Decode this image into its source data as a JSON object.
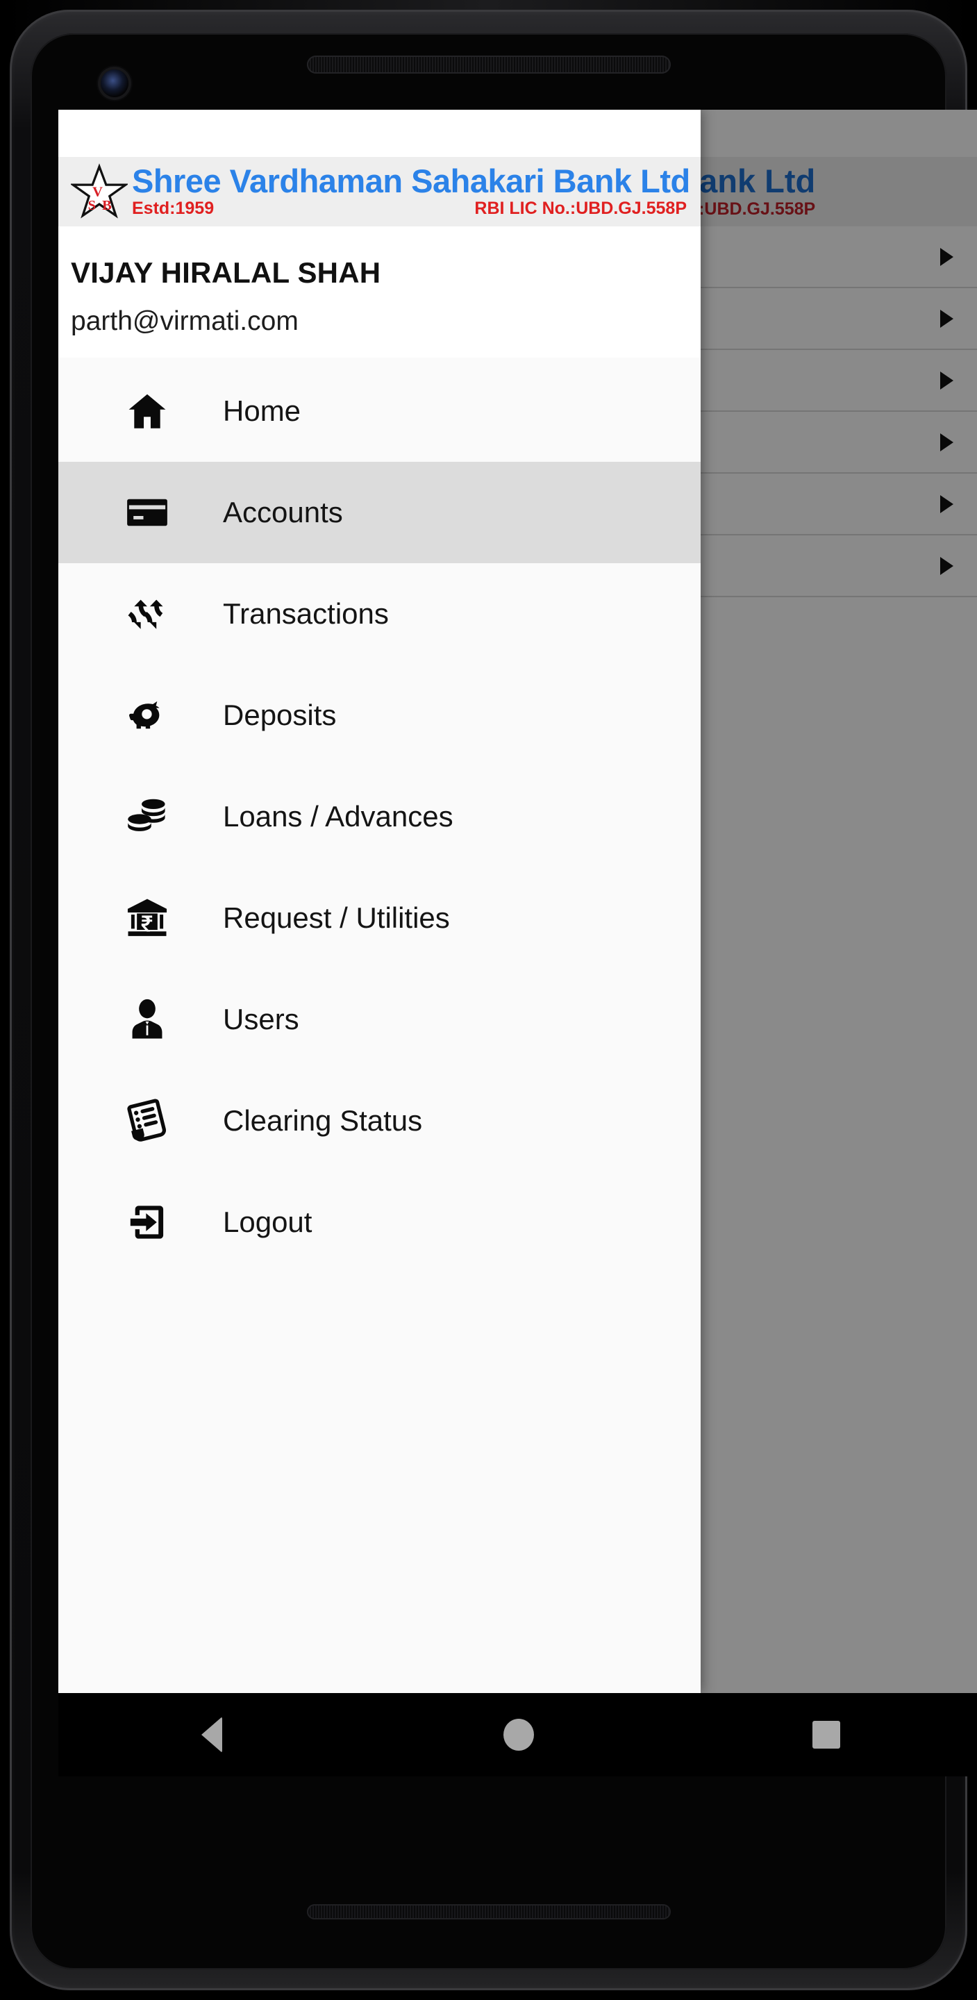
{
  "device": {
    "type": "android-phone",
    "camera_icon": "front-camera",
    "speaker_icon": "speaker-grille"
  },
  "bank_header": {
    "logo_icon": "star-logo-vsb",
    "logo_initials": "V S B",
    "name": "Shree Vardhaman Sahakari Bank Ltd",
    "established": "Estd:1959",
    "license": "RBI LIC No.:UBD.GJ.558P",
    "name_color": "#2b82e8",
    "sub_color": "#e02020",
    "band_bg": "#eeeeee"
  },
  "drawer": {
    "user": {
      "name": "VIJAY HIRALAL SHAH",
      "email": "parth@virmati.com"
    },
    "active_item": "Accounts",
    "active_bg": "#dcdcdc",
    "items": [
      {
        "label": "Home",
        "icon": "home-icon",
        "active": false
      },
      {
        "label": "Accounts",
        "icon": "credit-card-icon",
        "active": true
      },
      {
        "label": "Transactions",
        "icon": "exchange-arrows-icon",
        "active": false
      },
      {
        "label": "Deposits",
        "icon": "piggy-bank-icon",
        "active": false
      },
      {
        "label": "Loans / Advances",
        "icon": "coin-stack-icon",
        "active": false
      },
      {
        "label": "Request / Utilities",
        "icon": "bank-rupee-icon",
        "active": false
      },
      {
        "label": "Users",
        "icon": "user-person-icon",
        "active": false
      },
      {
        "label": "Clearing Status",
        "icon": "document-list-icon",
        "active": false
      },
      {
        "label": "Logout",
        "icon": "logout-arrow-icon",
        "active": false
      }
    ]
  },
  "background_app": {
    "scrim_color": "rgba(0,0,0,0.46)",
    "rows": [
      {
        "arrow_icon": "chevron-right-triangle-icon"
      },
      {
        "arrow_icon": "chevron-right-triangle-icon"
      },
      {
        "arrow_icon": "chevron-right-triangle-icon"
      },
      {
        "arrow_icon": "chevron-right-triangle-icon"
      },
      {
        "arrow_icon": "chevron-right-triangle-icon"
      },
      {
        "arrow_icon": "chevron-right-triangle-icon"
      }
    ]
  },
  "nav_bar": {
    "back_label": "Back",
    "home_label": "Home",
    "recents_label": "Recent apps",
    "icon_color": "#a8a8a8"
  }
}
